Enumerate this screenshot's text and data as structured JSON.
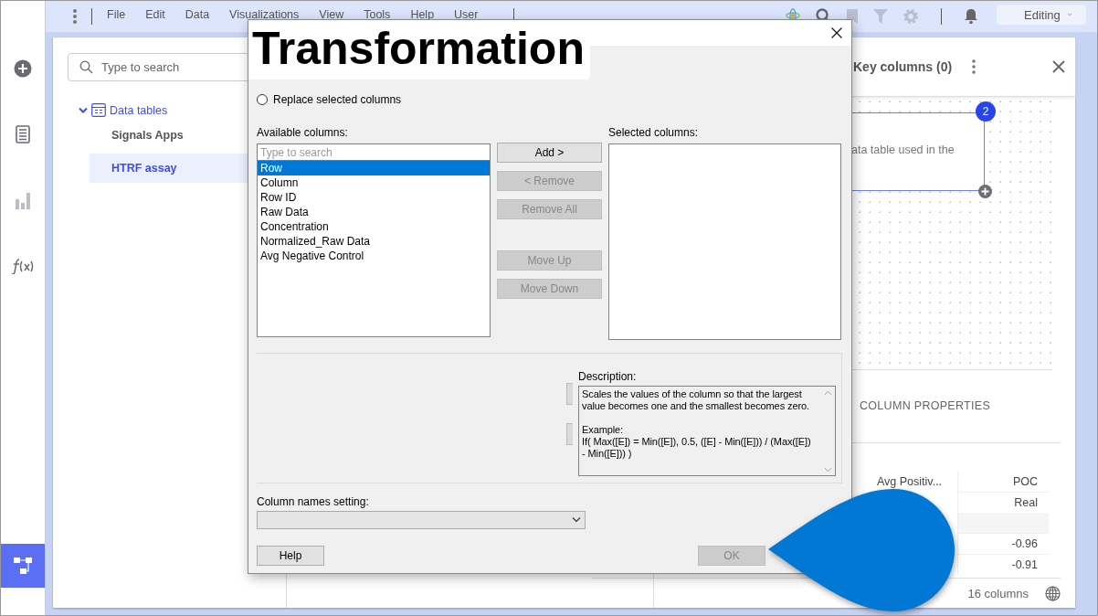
{
  "menu_bar": {
    "items": [
      "File",
      "Edit",
      "Data",
      "Visualizations",
      "View",
      "Tools",
      "Help",
      "User"
    ],
    "mode": "Editing"
  },
  "sidebar": {
    "items": [
      {
        "kind": "add",
        "selected": false
      },
      {
        "kind": "table",
        "selected": false
      },
      {
        "kind": "chart",
        "selected": false
      },
      {
        "kind": "formula",
        "selected": false
      },
      {
        "kind": "structure",
        "selected": true
      }
    ]
  },
  "data_panel": {
    "search": {
      "placeholder": "Type to search"
    },
    "tree": [
      {
        "label": "Data tables",
        "expanded": true,
        "children": [
          {
            "label": "Signals Apps",
            "selected": false
          },
          {
            "label": "HTRF assay",
            "selected": true
          }
        ]
      }
    ]
  },
  "details_panel": {
    "header": "Key columns (0)",
    "node": {
      "badge": "2",
      "text": "ata table used in the"
    },
    "tab": "COLUMN PROPERTIES",
    "table": {
      "columns": [
        "Avg Positiv...",
        "POC"
      ],
      "poc_cells": [
        "Real",
        "-0.96",
        "-0.91"
      ]
    },
    "footer": "16 columns"
  },
  "dialog": {
    "caption": "Transformation",
    "radio": {
      "label": "Replace selected columns",
      "checked": false
    },
    "available_label": "Available columns:",
    "search_placeholder": "Type to search",
    "items": [
      {
        "label": "Row",
        "selected": true
      },
      {
        "label": "Column",
        "selected": false
      },
      {
        "label": "Row ID",
        "selected": false
      },
      {
        "label": "Raw Data",
        "selected": false
      },
      {
        "label": "Concentration",
        "selected": false
      },
      {
        "label": "Normalized_Raw Data",
        "selected": false
      },
      {
        "label": "Avg Negative Control",
        "selected": false
      }
    ],
    "buttons": [
      {
        "label": "Add >",
        "disabled": false
      },
      {
        "label": "< Remove",
        "disabled": true
      },
      {
        "label": "Remove All",
        "disabled": true
      },
      {
        "label": "Move Up",
        "disabled": true
      },
      {
        "label": "Move Down",
        "disabled": true
      }
    ],
    "selected_label": "Selected columns:",
    "description_label": "Description:",
    "description": "Scales the values of the column so that the largest value becomes one and the smallest becomes zero.\n\nExample:\nIf( Max([E]) = Min([E]), 0.5, ([E] - Min([E])) / (Max([E]) - Min([E])) )",
    "column_names_label": "Column names setting:",
    "help": {
      "label": "Help",
      "disabled": false
    },
    "ok": {
      "label": "OK",
      "disabled": true
    }
  }
}
